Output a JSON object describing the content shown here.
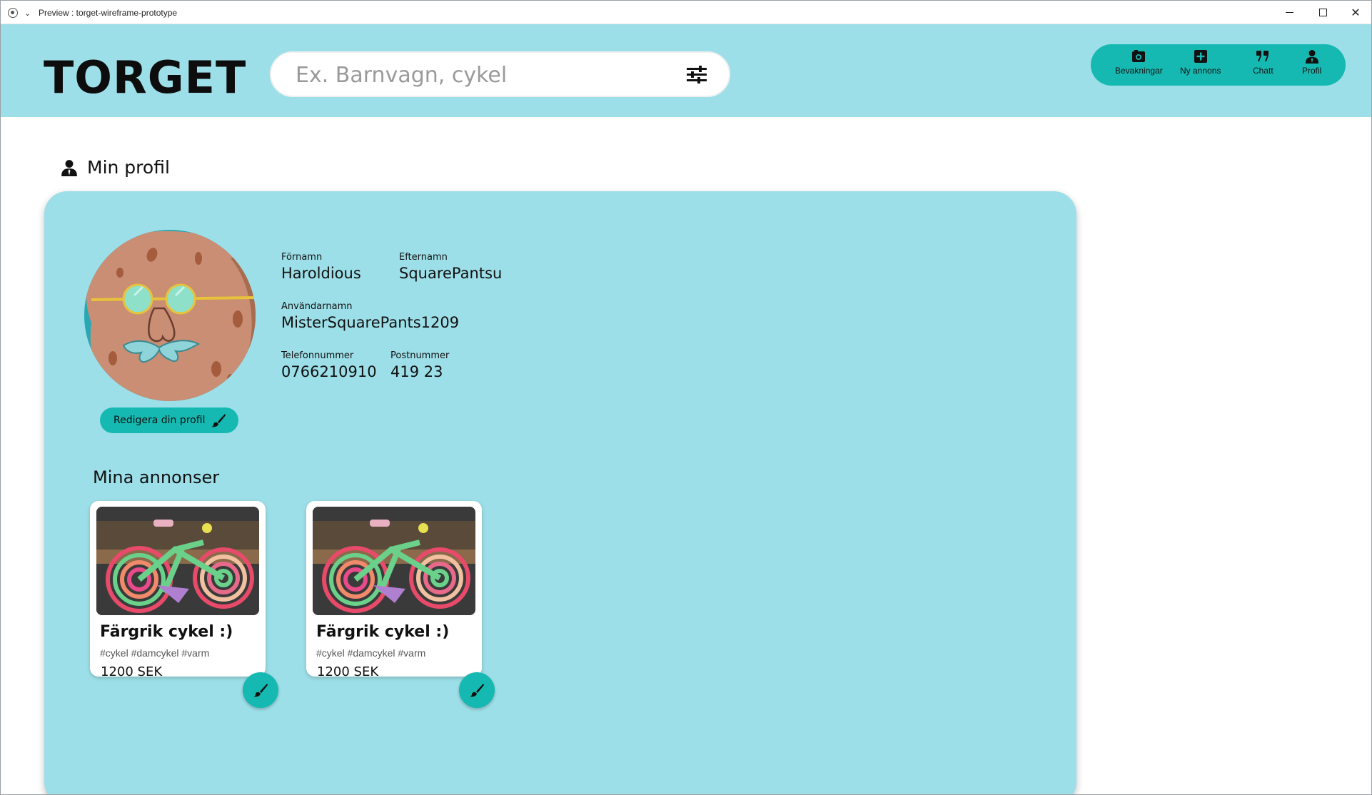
{
  "window": {
    "title": "Preview : torget-wireframe-prototype"
  },
  "header": {
    "logo": "TORGET",
    "search": {
      "placeholder": "Ex. Barnvagn, cykel",
      "value": ""
    },
    "nav": [
      {
        "label": "Bevakningar",
        "icon": "camera-icon"
      },
      {
        "label": "Ny annons",
        "icon": "plus-square-icon"
      },
      {
        "label": "Chatt",
        "icon": "quote-icon"
      },
      {
        "label": "Profil",
        "icon": "user-icon"
      }
    ]
  },
  "page": {
    "title": "Min profil"
  },
  "profile": {
    "first_name_label": "Förnamn",
    "first_name": "Haroldious",
    "last_name_label": "Efternamn",
    "last_name": "SquarePantsu",
    "username_label": "Användarnamn",
    "username": "MisterSquarePants1209",
    "phone_label": "Telefonnummer",
    "phone": "0766210910",
    "postal_label": "Postnummer",
    "postal": "419 23",
    "edit_button": "Redigera din profil"
  },
  "listings": {
    "section_title": "Mina annonser",
    "items": [
      {
        "title": "Färgrik cykel :)",
        "tags": "#cykel #damcykel #varm",
        "price": "1200 SEK"
      },
      {
        "title": "Färgrik cykel :)",
        "tags": "#cykel #damcykel #varm",
        "price": "1200 SEK"
      }
    ]
  },
  "colors": {
    "header_bg": "#9ddfe8",
    "accent": "#16b9b1",
    "panel_bg": "#9ddfe8"
  }
}
